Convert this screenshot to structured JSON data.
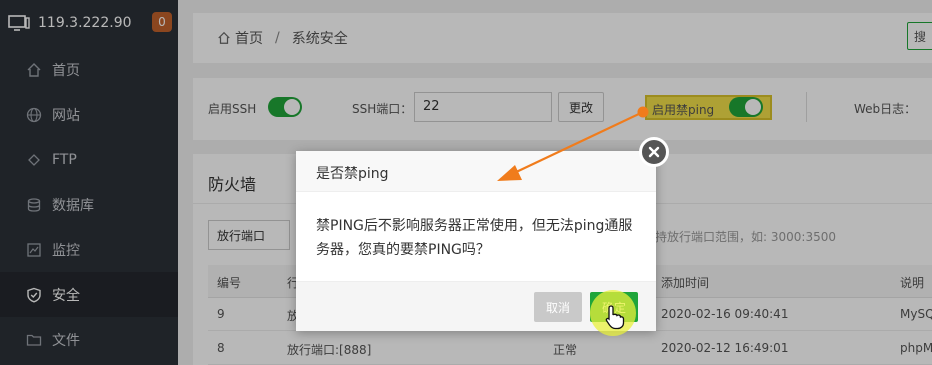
{
  "sidebar": {
    "server_ip": "119.3.222.90",
    "badge_count": "0",
    "items": [
      {
        "label": "首页",
        "icon": "home-icon"
      },
      {
        "label": "网站",
        "icon": "globe-icon"
      },
      {
        "label": "FTP",
        "icon": "ftp-icon"
      },
      {
        "label": "数据库",
        "icon": "database-icon"
      },
      {
        "label": "监控",
        "icon": "monitor-icon"
      },
      {
        "label": "安全",
        "icon": "shield-icon"
      },
      {
        "label": "文件",
        "icon": "folder-icon"
      }
    ],
    "active": "安全"
  },
  "breadcrumb": {
    "home": "首页",
    "separator": "/",
    "current": "系统安全"
  },
  "search_stub": "搜",
  "settings": {
    "ssh_label": "启用SSH",
    "port_label": "SSH端口：",
    "port_value": "22",
    "change_button": "更改",
    "ping_label": "启用禁ping",
    "web_log_label": "Web日志："
  },
  "firewall": {
    "title": "防火墙",
    "select_value": "放行端口",
    "hint": "持放行端口范围，如: 3000:3500",
    "columns": [
      "编号",
      "行",
      "添加时间",
      "说明"
    ],
    "rows": [
      {
        "id": "9",
        "action": "放",
        "status": "",
        "time": "2020-02-16 09:40:41",
        "note": "MySQ"
      },
      {
        "id": "8",
        "action": "放行端口:[888]",
        "status": "正常",
        "time": "2020-02-12 16:49:01",
        "note": "phpM"
      }
    ]
  },
  "modal": {
    "title": "是否禁ping",
    "message": "禁PING后不影响服务器正常使用，但无法ping通服务器，您真的要禁PING吗？",
    "cancel": "取消",
    "confirm": "确定"
  },
  "colors": {
    "accent": "#20a53a",
    "sidebar_bg": "#2c3138",
    "annotation": "#f07c1c",
    "highlight": "#f2e04a"
  }
}
